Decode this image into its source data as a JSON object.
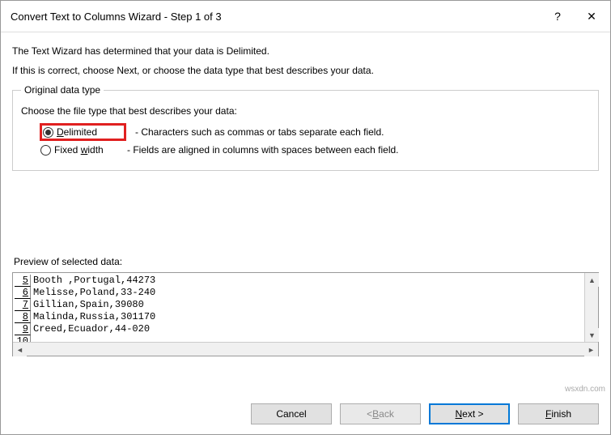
{
  "titlebar": {
    "title": "Convert Text to Columns Wizard - Step 1 of 3",
    "help": "?",
    "close": "✕"
  },
  "intro": {
    "line1": "The Text Wizard has determined that your data is Delimited.",
    "line2": "If this is correct, choose Next, or choose the data type that best describes your data."
  },
  "group": {
    "legend": "Original data type",
    "desc": "Choose the file type that best describes your data:",
    "options": [
      {
        "label_pre": "",
        "label_u": "D",
        "label_post": "elimited",
        "desc": "- Characters such as commas or tabs separate each field.",
        "checked": true
      },
      {
        "label_pre": "Fixed ",
        "label_u": "w",
        "label_post": "idth",
        "desc": "- Fields are aligned in columns with spaces between each field.",
        "checked": false
      }
    ]
  },
  "preview": {
    "label": "Preview of selected data:",
    "rows": [
      {
        "n": "5",
        "text": "Booth ,Portugal,44273"
      },
      {
        "n": "6",
        "text": "Melisse,Poland,33-240"
      },
      {
        "n": "7",
        "text": "Gillian,Spain,39080"
      },
      {
        "n": "8",
        "text": "Malinda,Russia,301170"
      },
      {
        "n": "9",
        "text": "Creed,Ecuador,44-020"
      },
      {
        "n": "10",
        "text": ""
      }
    ]
  },
  "buttons": {
    "cancel": "Cancel",
    "back_pre": "< ",
    "back_u": "B",
    "back_post": "ack",
    "next_u": "N",
    "next_post": "ext >",
    "finish_u": "F",
    "finish_post": "inish"
  },
  "watermark": "wsxdn.com"
}
